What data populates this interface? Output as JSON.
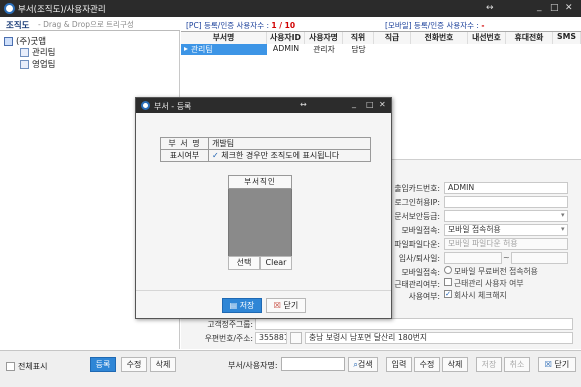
{
  "window": {
    "title": "부서(조직도)/사용자관리"
  },
  "org": {
    "title": "조직도",
    "hint": "- Drag & Drop으로 트리구성",
    "root": "(주)굿앱",
    "children": [
      "관리팀",
      "영업팀"
    ]
  },
  "registration": {
    "pc_label": "[PC] 등록/인증 사용자수 :",
    "pc_count": "1 / 10",
    "mobile_label": "[모바일] 등록/인증 사용자수 :",
    "mobile_count": "-"
  },
  "grid": {
    "headers": [
      "부서명",
      "사용자ID",
      "사용자명",
      "직위",
      "직급",
      "전화번호",
      "내선번호",
      "휴대전화",
      "SMS"
    ],
    "row": [
      "관리팀",
      "ADMIN",
      "관리자",
      "담당"
    ]
  },
  "detail": {
    "fields": [
      {
        "label": "출입카드번호:",
        "value": "ADMIN",
        "disabled": false
      },
      {
        "label": "로그인허용IP:",
        "value": "",
        "disabled": false
      },
      {
        "label": "문서보안등급:",
        "value": "",
        "disabled": false
      },
      {
        "label": "모바일접속:",
        "value": "모바일 접속허용",
        "disabled": false
      },
      {
        "label": "파일파일다운:",
        "value": "모바일 파일다운 허용",
        "disabled": true
      },
      {
        "label": "입사/퇴사일:",
        "value": "~",
        "disabled": true
      }
    ],
    "mobile_access_label": "모바일접속:",
    "mobile_access_value": "모바일 무료버전 접속허용",
    "attendance_label": "근태관리여부:",
    "attendance_value": "근태관리 사용자 여부",
    "use_label": "사용여부:",
    "use_value": "회사시 체크해지",
    "email_label": "고객정주그룹:",
    "address_label": "우편번호/주소:",
    "zip": "355881",
    "address": "충남 보령시 남포면 달산리 180번지"
  },
  "bottom": {
    "show_all": "전체표시",
    "register": "등록",
    "edit": "수정",
    "delete": "삭제",
    "search_label": "부서/사용자명:",
    "search_btn": "검색",
    "input": "입력",
    "edit2": "수정",
    "delete2": "삭제",
    "save": "저장",
    "cancel": "취소",
    "close": "닫기"
  },
  "dialog": {
    "title": "부서 - 등록",
    "dept_label": "부 서 명",
    "dept_value": "개발팀",
    "display_label": "표시여부",
    "display_value": "체크한 경우만 조직도에 표시됩니다",
    "photo_title": "부서직인",
    "select": "선택",
    "clear": "Clear",
    "save": "저장",
    "close": "닫기"
  }
}
